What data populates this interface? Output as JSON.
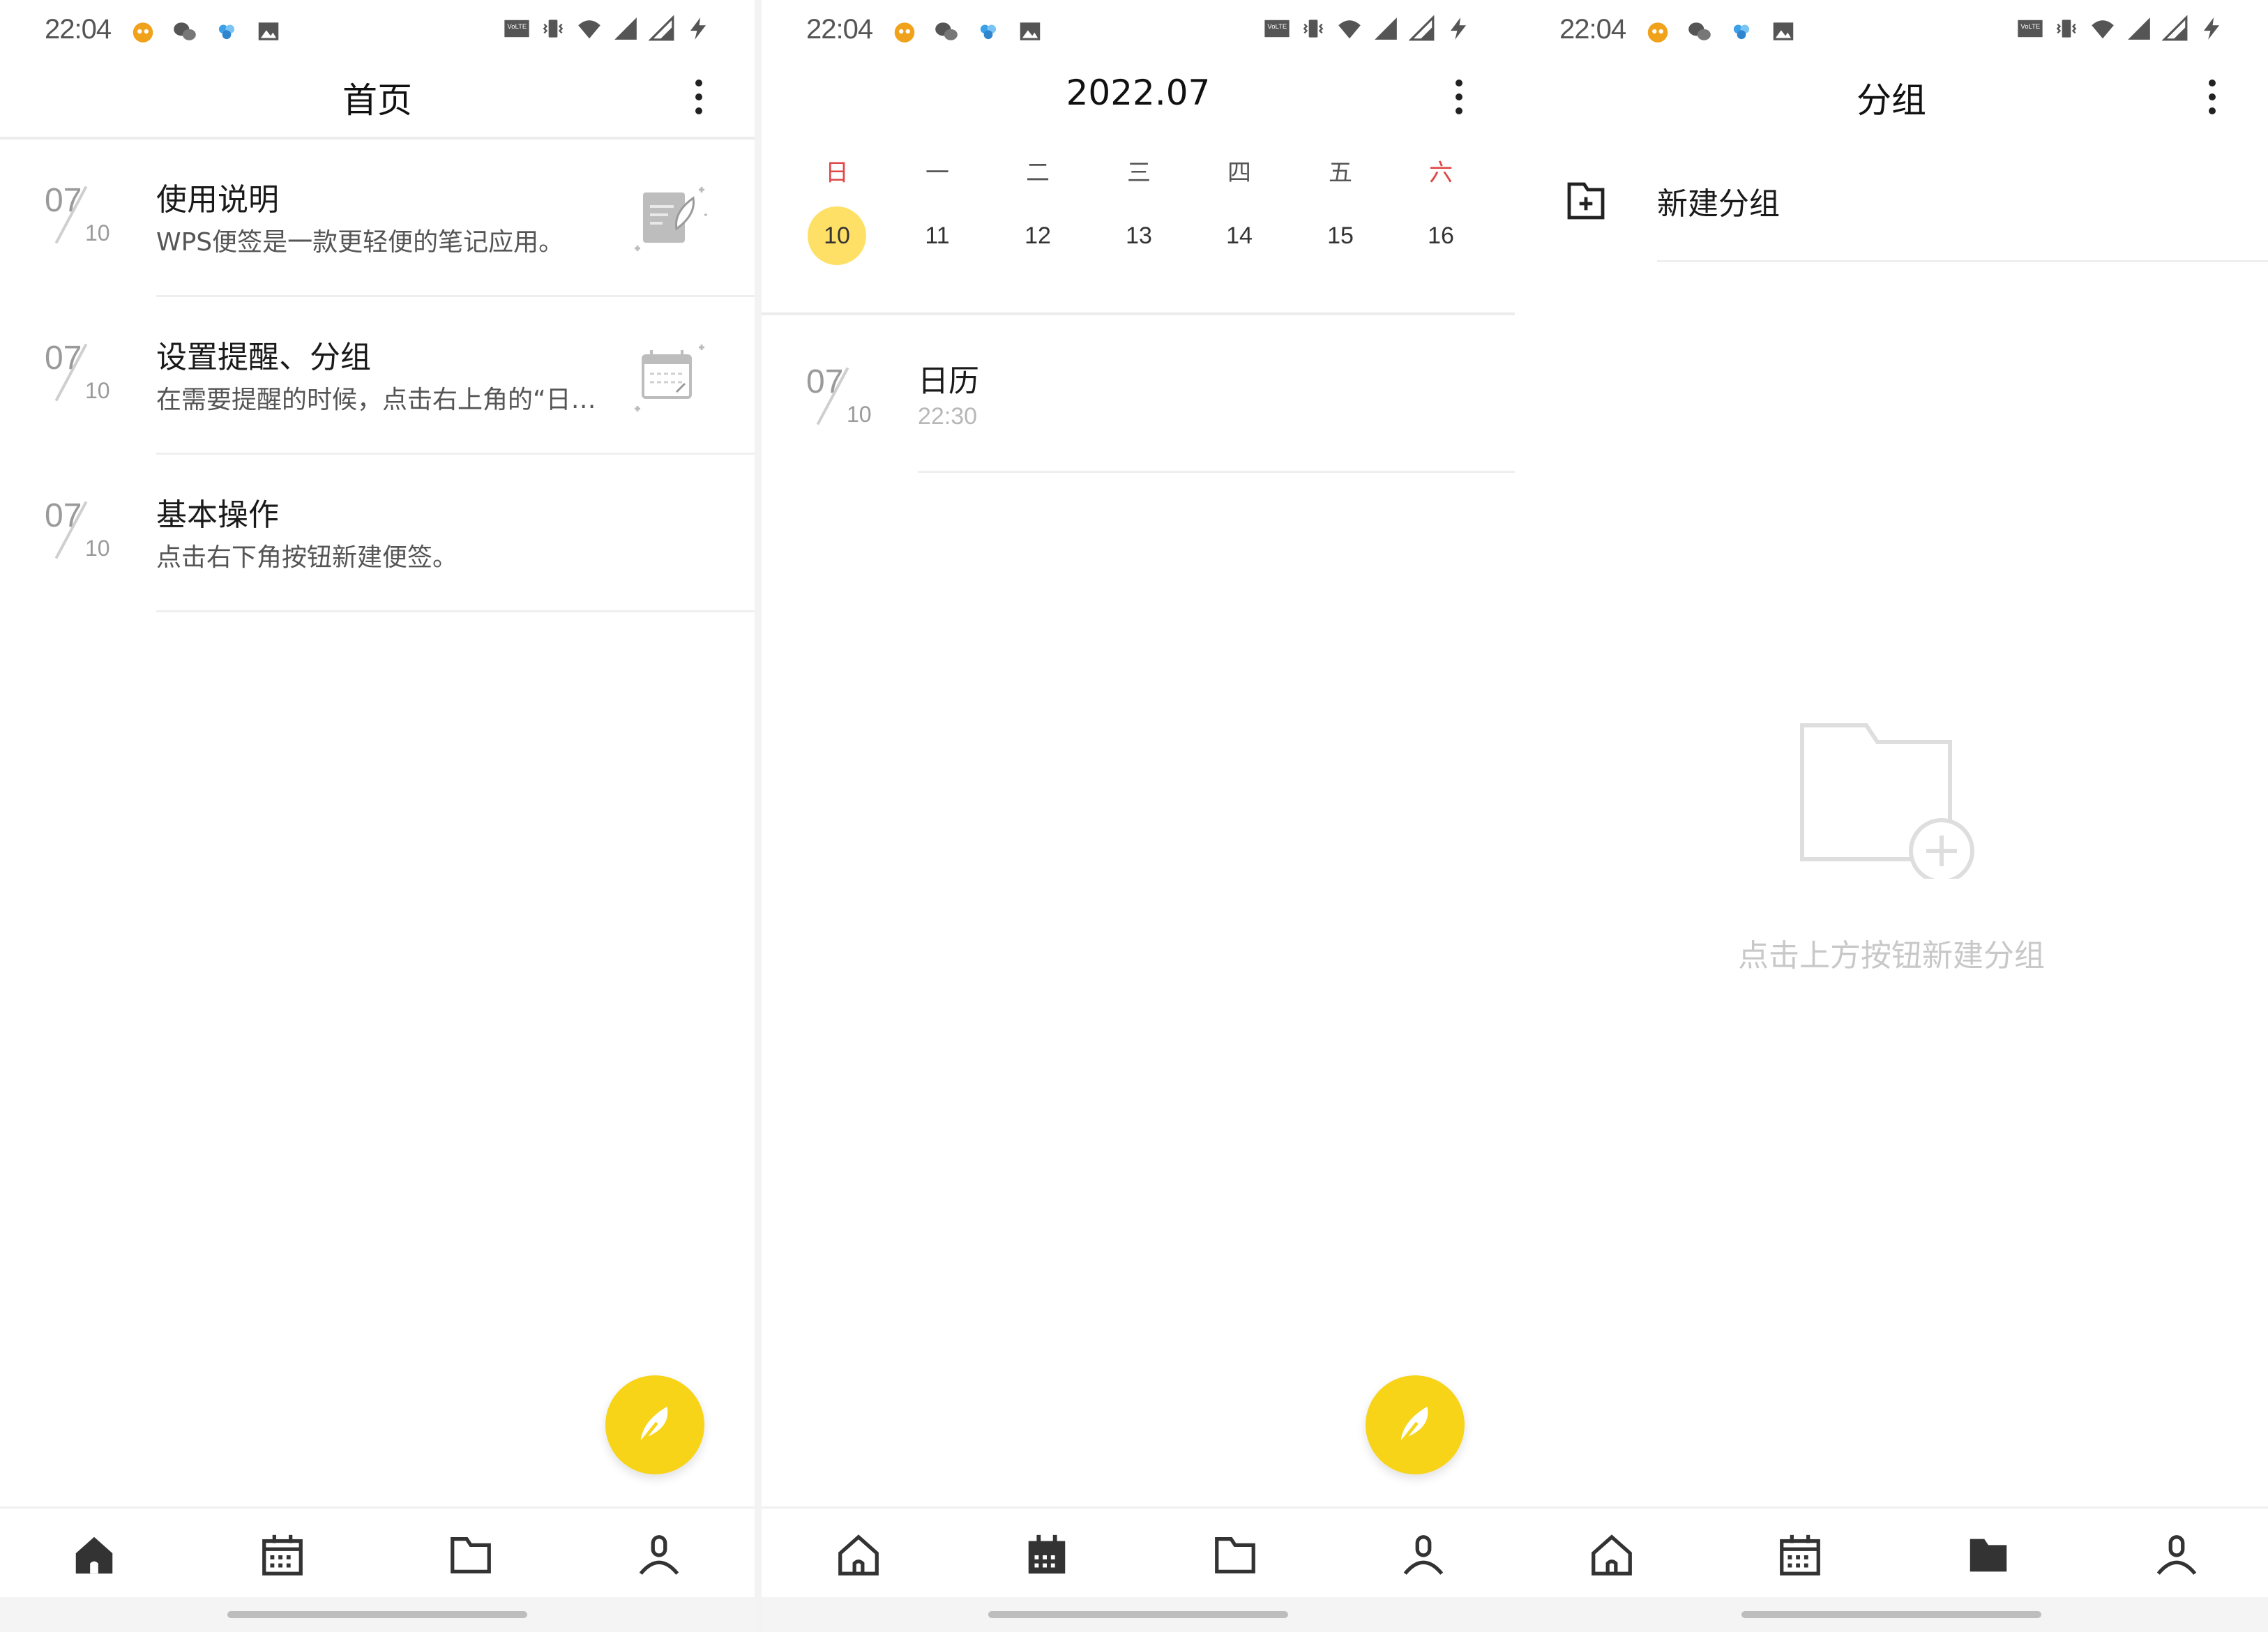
{
  "status_bar": {
    "time": "22:04"
  },
  "home": {
    "title": "首页",
    "notes": [
      {
        "month": "07",
        "day": "10",
        "title": "使用说明",
        "desc": "WPS便签是一款更轻便的笔记应用。",
        "icon": "note-feather-illustration"
      },
      {
        "month": "07",
        "day": "10",
        "title": "设置提醒、分组",
        "desc": "在需要提醒的时候，点击右上角的“日…",
        "icon": "calendar-illustration"
      },
      {
        "month": "07",
        "day": "10",
        "title": "基本操作",
        "desc": "点击右下角按钮新建便签。",
        "icon": ""
      }
    ]
  },
  "calendar": {
    "title": "2022.07",
    "weekdays": [
      "日",
      "一",
      "二",
      "三",
      "四",
      "五",
      "六"
    ],
    "days": [
      "10",
      "11",
      "12",
      "13",
      "14",
      "15",
      "16"
    ],
    "selected_day": "10",
    "event": {
      "month": "07",
      "day": "10",
      "title": "日历",
      "time": "22:30"
    }
  },
  "groups": {
    "title": "分组",
    "new_group_label": "新建分组",
    "empty_hint": "点击上方按钮新建分组"
  },
  "nav": {
    "tabs": [
      "home-icon",
      "calendar-icon",
      "folder-icon",
      "profile-icon"
    ]
  },
  "colors": {
    "accent": "#f7d417",
    "selected_day": "#ffe066",
    "weekend_red": "#e04848"
  }
}
